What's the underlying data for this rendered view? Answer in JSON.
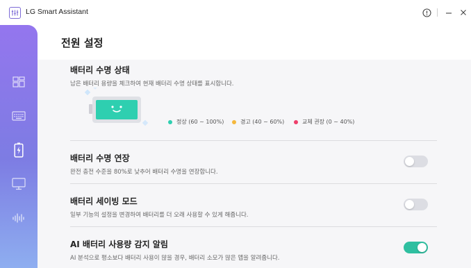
{
  "app": {
    "title": "LG Smart Assistant"
  },
  "window_controls": {
    "info": "i",
    "minimize": "—",
    "close": "✕"
  },
  "sidebar": {
    "items": [
      {
        "name": "dashboard-icon"
      },
      {
        "name": "keyboard-icon"
      },
      {
        "name": "battery-icon",
        "active": true
      },
      {
        "name": "display-icon"
      },
      {
        "name": "audio-wave-icon"
      }
    ]
  },
  "page": {
    "title": "전원 설정"
  },
  "battery_health": {
    "title": "배터리 수명 상태",
    "desc": "남은 배터리 용량을 체크하여 현재 배터리 수명 상태를 표시합니다.",
    "face": "˘ ˘",
    "legend": [
      {
        "label": "정상 (60 ~ 100%)",
        "color": "#2ecfb0"
      },
      {
        "label": "경고 (40 ~ 60%)",
        "color": "#f5b83d"
      },
      {
        "label": "교체 권장 (0 ~ 40%)",
        "color": "#ee3f6b"
      }
    ]
  },
  "extend": {
    "title": "배터리 수명 연장",
    "desc": "완전 충전 수준을 80%로 낮추어 배터리 수명을 연장합니다.",
    "enabled": false
  },
  "saving": {
    "title": "배터리 세이빙 모드",
    "desc": "일부 기능의 설정을 변경하여 배터리를 더 오래 사용할 수 있게 해줍니다.",
    "enabled": false
  },
  "ai_alert": {
    "title": "AI 배터리 사용량 감지 알림",
    "desc": "AI 분석으로 평소보다 배터리 사용이 많을 경우, 배터리 소모가 많은 앱을 알려줍니다.",
    "enabled": true
  },
  "colors": {
    "accent": "#2fbfa0",
    "sidebar_top": "#9476ee",
    "sidebar_bottom": "#8eaef0"
  }
}
